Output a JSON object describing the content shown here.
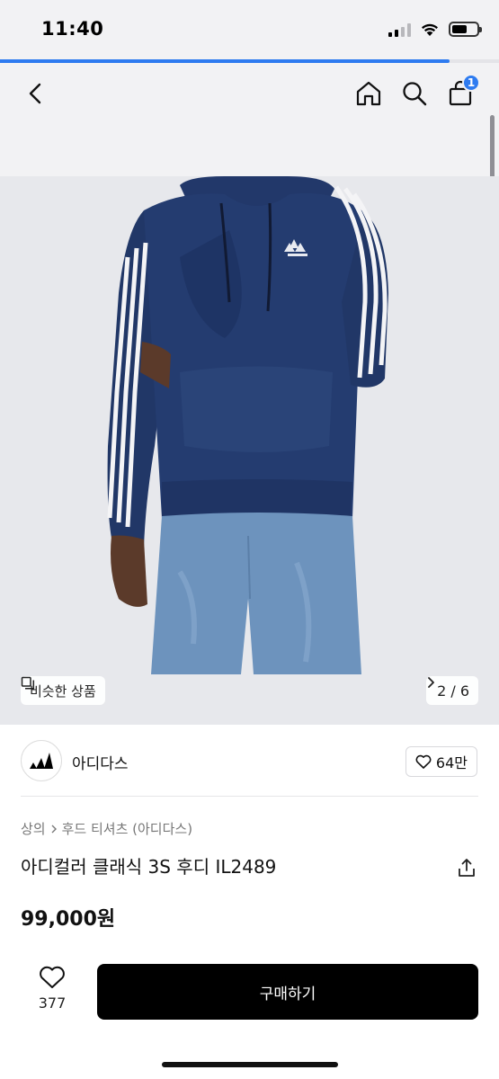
{
  "status_bar": {
    "time": "11:40",
    "icons": [
      "signal-icon",
      "wifi-icon",
      "battery-icon"
    ]
  },
  "loading_progress": 0.9,
  "nav": {
    "icons": [
      "back-icon",
      "home-icon",
      "search-icon",
      "shopping-bag-icon"
    ],
    "cart_count": "1"
  },
  "gallery": {
    "similar_label": "비슷한 상품",
    "page_indicator": "2 / 6"
  },
  "shop": {
    "name": "아디다스",
    "like_count": "64만"
  },
  "product": {
    "breadcrumb": [
      "상의",
      "후드 티셔츠 (아디다스)"
    ],
    "title": "아디컬러 클래식 3S 후디 IL2489",
    "price": "99,000원"
  },
  "bottom_bar": {
    "wish_count": "377",
    "buy_label": "구매하기"
  },
  "colors": {
    "accent": "#2e7bf0",
    "hoodie": "#233a6b",
    "buy_button": "#000000"
  }
}
